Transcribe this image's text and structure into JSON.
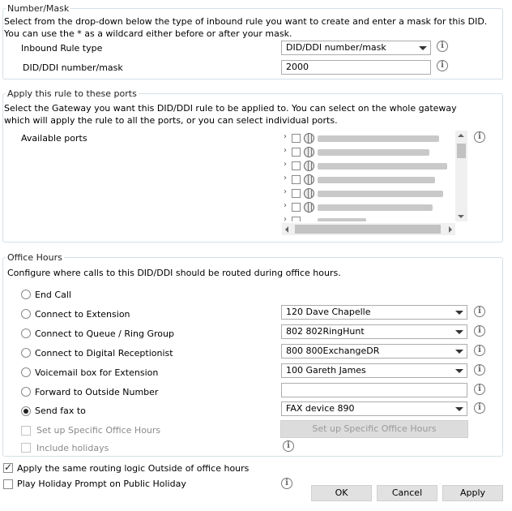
{
  "number_mask": {
    "legend": "Number/Mask",
    "description": "Select from the drop-down below the type of inbound rule you want to create and enter a mask for this DID. You can use the * as a wildcard either before or after your mask.",
    "rule_type_label": "Inbound Rule type",
    "rule_type_value": "DID/DDI number/mask",
    "mask_label": "DID/DDI number/mask",
    "mask_value": "2000"
  },
  "ports": {
    "legend": "Apply this rule to these ports",
    "description": "Select the Gateway you want this DID/DDI rule to be applied to. You can select on the whole gateway which will apply the rule to all the ports, or you can select individual ports.",
    "available_label": "Available ports"
  },
  "office_hours": {
    "legend": "Office Hours",
    "description": "Configure where calls to this DID/DDI should be routed during office hours.",
    "options": [
      {
        "label": "End Call",
        "value": ""
      },
      {
        "label": "Connect to Extension",
        "value": "120 Dave Chapelle"
      },
      {
        "label": "Connect to Queue / Ring Group",
        "value": "802 802RingHunt"
      },
      {
        "label": "Connect to Digital Receptionist",
        "value": "800 800ExchangeDR"
      },
      {
        "label": "Voicemail box for Extension",
        "value": "100 Gareth James"
      },
      {
        "label": "Forward to Outside Number",
        "value": ""
      },
      {
        "label": "Send fax to",
        "value": "FAX device 890"
      }
    ],
    "specific_hours_label": "Set up Specific Office Hours",
    "specific_hours_button": "Set up Specific Office Hours",
    "include_holidays_label": "Include holidays"
  },
  "footer": {
    "same_routing_label": "Apply the same routing logic Outside of office hours",
    "holiday_prompt_label": "Play Holiday Prompt on Public Holiday",
    "ok": "OK",
    "cancel": "Cancel",
    "apply": "Apply"
  },
  "icons": {
    "info": "i"
  }
}
